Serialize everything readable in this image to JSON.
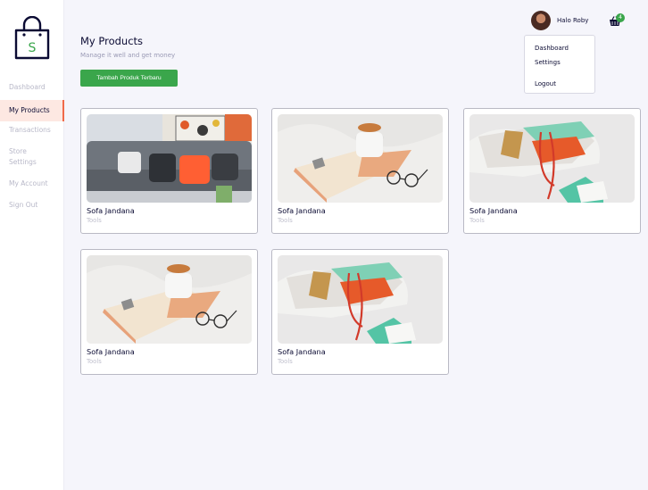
{
  "brand": {
    "logo_letter": "S",
    "accent": "#3aa64b",
    "active_accent": "#f06a4a"
  },
  "sidebar": {
    "items": [
      {
        "label": "Dashboard",
        "active": false
      },
      {
        "label": "My Products",
        "active": true
      },
      {
        "label": "Transactions",
        "active": false
      },
      {
        "label": "Store Settings",
        "active": false
      },
      {
        "label": "My Account",
        "active": false
      },
      {
        "label": "Sign Out",
        "active": false
      }
    ]
  },
  "header": {
    "title": "My Products",
    "subtitle": "Manage it well and get money",
    "add_button": "Tambah Produk Terbaru"
  },
  "user": {
    "greeting": "Halo Roby",
    "cart_count": "4"
  },
  "dropdown": {
    "items": [
      "Dashboard",
      "Settings",
      "Logout"
    ]
  },
  "products": [
    {
      "name": "Sofa Jandana",
      "category": "Tools",
      "image": "sofa"
    },
    {
      "name": "Sofa Jandana",
      "category": "Tools",
      "image": "coffee"
    },
    {
      "name": "Sofa Jandana",
      "category": "Tools",
      "image": "sneakers"
    },
    {
      "name": "Sofa Jandana",
      "category": "Tools",
      "image": "coffee"
    },
    {
      "name": "Sofa Jandana",
      "category": "Tools",
      "image": "sneakers"
    }
  ]
}
